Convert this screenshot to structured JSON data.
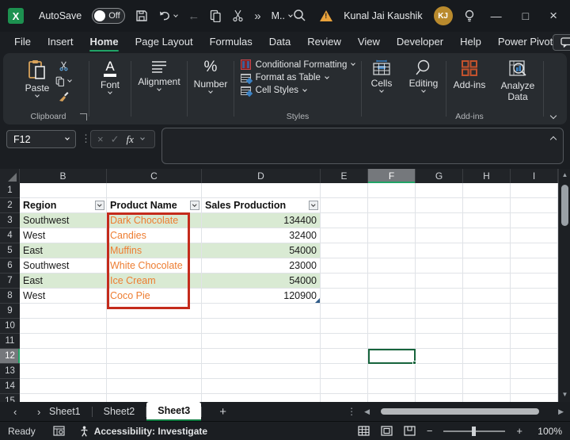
{
  "titlebar": {
    "app_icon_letter": "X",
    "autosave_label": "AutoSave",
    "autosave_state": "Off",
    "overflow_glyph": "»",
    "more_label": "M..",
    "back_glyph": "←",
    "user_name": "Kunal Jai Kaushik",
    "user_initials": "KJ",
    "minimize_glyph": "—",
    "maximize_glyph": "□",
    "close_glyph": "×"
  },
  "menu": {
    "tabs": [
      "File",
      "Insert",
      "Home",
      "Page Layout",
      "Formulas",
      "Data",
      "Review",
      "View",
      "Developer",
      "Help",
      "Power Pivot"
    ],
    "active_tab": "Home"
  },
  "ribbon": {
    "paste_label": "Paste",
    "clipboard_group_label": "Clipboard",
    "font_label": "Font",
    "font_glyph": "A",
    "alignment_label": "Alignment",
    "number_label": "Number",
    "number_glyph": "%",
    "styles_items": [
      "Conditional Formatting",
      "Format as Table",
      "Cell Styles"
    ],
    "styles_group_label": "Styles",
    "cells_label": "Cells",
    "editing_label": "Editing",
    "addins_label": "Add-ins",
    "addins_group_label": "Add-ins",
    "analyze_data_label": "Analyze Data"
  },
  "formula_bar": {
    "name_box_value": "F12",
    "dots_glyph": "⋮",
    "cancel_glyph": "×",
    "enter_glyph": "✓",
    "fx_label": "fx",
    "formula_value": ""
  },
  "sheet": {
    "columns": [
      "B",
      "C",
      "D",
      "E",
      "F",
      "G",
      "H",
      "I"
    ],
    "selected_column": "F",
    "row_count": 15,
    "selected_row": 12,
    "active_cell": "F12",
    "table": {
      "header_row": 2,
      "headers": [
        "Region",
        "Product Name",
        "Sales Production"
      ],
      "rows": [
        {
          "region": "Southwest",
          "product": "Dark Chocolate",
          "sales": "134400"
        },
        {
          "region": "West",
          "product": "Candies",
          "sales": "32400"
        },
        {
          "region": "East",
          "product": "Muffins",
          "sales": "54000"
        },
        {
          "region": "Southwest",
          "product": "White Chocolate",
          "sales": "23000"
        },
        {
          "region": "East",
          "product": "Ice Cream",
          "sales": "54000"
        },
        {
          "region": "West",
          "product": "Coco Pie",
          "sales": "120900"
        }
      ]
    }
  },
  "sheet_tabs": {
    "prev_glyph": "‹",
    "next_glyph": "›",
    "sheets": [
      "Sheet1",
      "Sheet2",
      "Sheet3"
    ],
    "active_sheet": "Sheet3",
    "add_glyph": "+",
    "menu_glyph": "⋮",
    "scroll_left_glyph": "◀",
    "scroll_right_glyph": "▶"
  },
  "status_bar": {
    "ready_label": "Ready",
    "accessibility_label": "Accessibility: Investigate",
    "zoom_minus_glyph": "−",
    "zoom_plus_glyph": "+",
    "zoom_level": "100%"
  },
  "colors": {
    "excel_green": "#21A366",
    "selection_green": "#17643C",
    "table_band_green": "#D9EAD3",
    "product_text_orange": "#ED7D31",
    "annotation_red": "#C42B1C",
    "avatar_gold": "#B98A2D",
    "warning_yellow": "#E9A23B"
  }
}
